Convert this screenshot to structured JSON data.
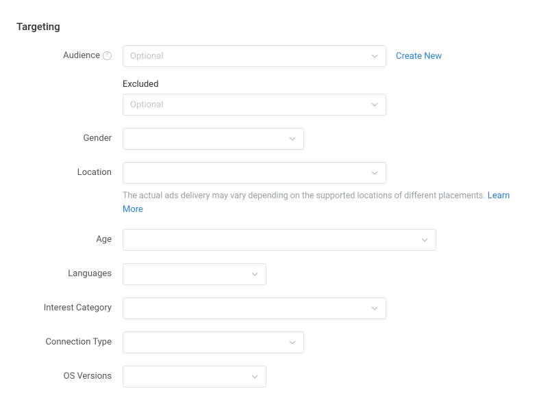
{
  "section_title": "Targeting",
  "labels": {
    "audience": "Audience",
    "excluded": "Excluded",
    "gender": "Gender",
    "location": "Location",
    "age": "Age",
    "languages": "Languages",
    "interest_category": "Interest Category",
    "connection_type": "Connection Type",
    "os_versions": "OS Versions"
  },
  "placeholders": {
    "audience": "Optional",
    "excluded": "Optional"
  },
  "links": {
    "create_new": "Create New",
    "learn_more": "Learn More"
  },
  "helper": {
    "location": "The actual ads delivery may vary depending on the supported locations of different placements."
  },
  "help_glyph": "?"
}
